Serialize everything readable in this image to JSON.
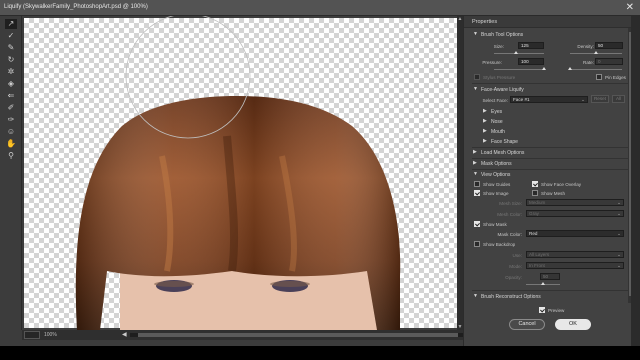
{
  "window": {
    "title": "Liquify (SkywalkerFamily_PhotoshopArt.psd @ 100%)",
    "close_glyph": "✕"
  },
  "tools": [
    {
      "name": "forward-warp-tool-icon",
      "glyph": "↗",
      "selected": true
    },
    {
      "name": "reconstruct-tool-icon",
      "glyph": "✓"
    },
    {
      "name": "smooth-tool-icon",
      "glyph": "✎"
    },
    {
      "name": "twirl-clockwise-tool-icon",
      "glyph": "↻"
    },
    {
      "name": "pucker-tool-icon",
      "glyph": "✲"
    },
    {
      "name": "bloat-tool-icon",
      "glyph": "◈"
    },
    {
      "name": "push-left-tool-icon",
      "glyph": "⇐"
    },
    {
      "name": "freeze-mask-tool-icon",
      "glyph": "✐"
    },
    {
      "name": "thaw-mask-tool-icon",
      "glyph": "✑"
    },
    {
      "name": "face-tool-icon",
      "glyph": "☺"
    },
    {
      "name": "hand-tool-icon",
      "glyph": "✋"
    },
    {
      "name": "zoom-tool-icon",
      "glyph": "⚲"
    }
  ],
  "status": {
    "zoom": "100%",
    "left_arrow": "◀",
    "right_arrow": "▶"
  },
  "panel": {
    "title": "Properties",
    "brush_tool_options": {
      "label": "Brush Tool Options",
      "size_label": "Size:",
      "size": "125",
      "density_label": "Density:",
      "density": "50",
      "pressure_label": "Pressure:",
      "pressure": "100",
      "rate_label": "Rate:",
      "rate": "0",
      "stylus_pressure": "Stylus Pressure",
      "pin_edges": "Pin Edges"
    },
    "face_aware": {
      "label": "Face-Aware Liquify",
      "select_face_label": "Select Face:",
      "select_face_value": "Face #1",
      "reset": "Reset",
      "all": "All",
      "subsections": [
        "Eyes",
        "Nose",
        "Mouth",
        "Face Shape"
      ]
    },
    "load_mesh_options": "Load Mesh Options",
    "mask_options": "Mask Options",
    "view_options": {
      "label": "View Options",
      "show_guides": "Show Guides",
      "show_face_overlay": "Show Face Overlay",
      "show_image": "Show Image",
      "show_mesh": "Show Mesh",
      "mesh_size_label": "Mesh Size:",
      "mesh_size_value": "Medium",
      "mesh_color_label": "Mesh Color:",
      "mesh_color_value": "Gray",
      "show_mask": "Show Mask",
      "mask_color_label": "Mask Color:",
      "mask_color_value": "Red",
      "show_backdrop": "Show Backdrop",
      "use_label": "Use:",
      "use_value": "All Layers",
      "mode_label": "Mode:",
      "mode_value": "In Front",
      "opacity_label": "Opacity:",
      "opacity_value": "50"
    },
    "brush_reconstruct_options": "Brush Reconstruct Options",
    "preview": "Preview",
    "cancel": "Cancel",
    "ok": "OK",
    "chevron": "⌄",
    "tri_down": "▼",
    "tri_right": "▶"
  },
  "colors": {
    "hair_dark": "#5a2c12",
    "hair_mid": "#8a4620",
    "hair_light": "#b06a3a",
    "skin": "#e8c3ae",
    "eyes": "#4a4058"
  },
  "sliders": {
    "size": 0.43,
    "density": 0.5,
    "pressure": 1.0,
    "rate": 0.0,
    "opacity": 0.5
  }
}
